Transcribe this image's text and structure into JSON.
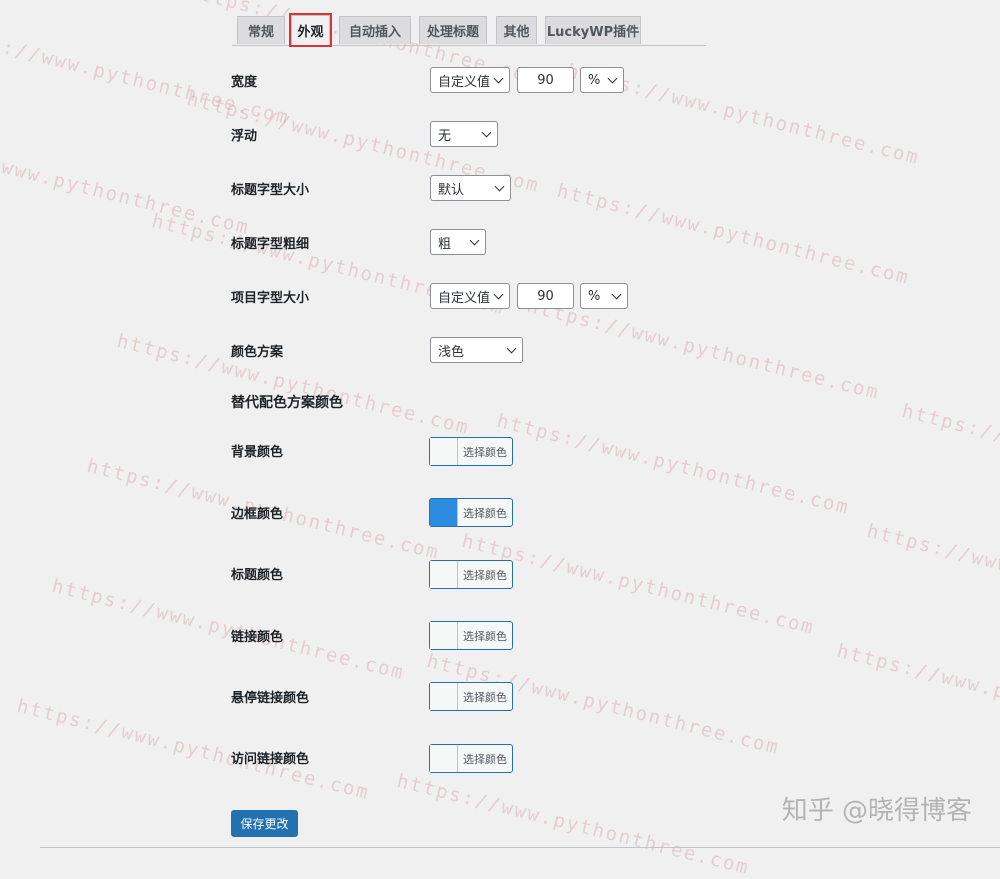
{
  "tabs": [
    {
      "label": "常规",
      "active": false
    },
    {
      "label": "外观",
      "active": true
    },
    {
      "label": "自动插入",
      "active": false
    },
    {
      "label": "处理标题",
      "active": false
    },
    {
      "label": "其他",
      "active": false
    },
    {
      "label": "LuckyWP插件",
      "active": false
    }
  ],
  "settings": {
    "width": {
      "label": "宽度",
      "mode": "自定义值",
      "value": "90",
      "unit": "%"
    },
    "float": {
      "label": "浮动",
      "value": "无"
    },
    "title_font_size": {
      "label": "标题字型大小",
      "value": "默认"
    },
    "title_font_weight": {
      "label": "标题字型粗细",
      "value": "粗"
    },
    "item_font_size": {
      "label": "项目字型大小",
      "mode": "自定义值",
      "value": "90",
      "unit": "%"
    },
    "color_scheme": {
      "label": "颜色方案",
      "value": "浅色"
    }
  },
  "alt_colors": {
    "title": "替代配色方案颜色",
    "button_label": "选择颜色",
    "items": [
      {
        "label": "背景颜色",
        "color": "#f6f7f7"
      },
      {
        "label": "边框颜色",
        "color": "#2c8ce0"
      },
      {
        "label": "标题颜色",
        "color": "#f6f7f7"
      },
      {
        "label": "链接颜色",
        "color": "#f6f7f7"
      },
      {
        "label": "悬停链接颜色",
        "color": "#f6f7f7"
      },
      {
        "label": "访问链接颜色",
        "color": "#f6f7f7"
      }
    ]
  },
  "save_button": "保存更改",
  "watermark": {
    "site": "https://www.pythonthree.com",
    "brand": "知乎 @晓得博客"
  },
  "colors": {
    "accent": "#2271b1",
    "active_tab_outline": "#d63638"
  }
}
